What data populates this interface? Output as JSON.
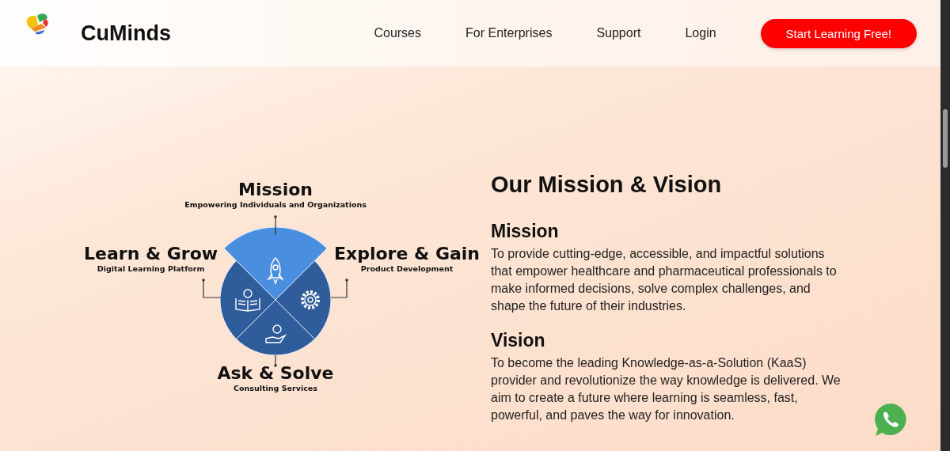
{
  "header": {
    "brand": "CuMinds",
    "nav": [
      {
        "label": "Courses"
      },
      {
        "label": "For Enterprises"
      },
      {
        "label": "Support"
      },
      {
        "label": "Login"
      }
    ],
    "cta": "Start Learning Free!"
  },
  "diagram": {
    "segments": [
      {
        "kind": "top",
        "title": "Mission",
        "subtitle": "Empowering Individuals and Organizations"
      },
      {
        "kind": "left",
        "title": "Learn & Grow",
        "subtitle": "Digital Learning Platform"
      },
      {
        "kind": "right",
        "title": "Explore & Gain",
        "subtitle": "Product Development"
      },
      {
        "kind": "bottom",
        "title": "Ask & Solve",
        "subtitle": "Consulting Services"
      }
    ]
  },
  "content": {
    "heading": "Our Mission & Vision",
    "sections": [
      {
        "title": "Mission",
        "text": "To provide cutting-edge, accessible, and impactful solutions that empower healthcare and pharmaceutical professionals to make informed decisions, solve complex challenges, and shape the future of their industries."
      },
      {
        "title": "Vision",
        "text": "To become the leading Knowledge-as-a-Solution (KaaS) provider and revolutionize the way knowledge is delivered. We aim to create a future where learning is seamless, fast, powerful, and paves the way for innovation."
      }
    ]
  }
}
